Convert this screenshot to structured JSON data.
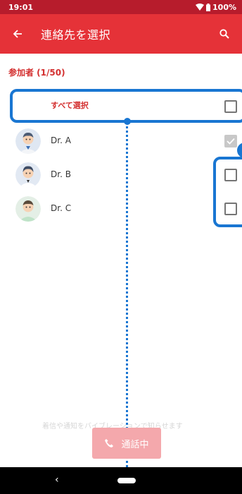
{
  "status_bar": {
    "time": "19:01",
    "battery": "100%",
    "icons": [
      "wifi-icon",
      "battery-icon"
    ]
  },
  "app_bar": {
    "title": "連絡先を選択",
    "back_icon": "arrow-left-icon",
    "search_icon": "search-icon"
  },
  "section": {
    "header": "参加者 (1/50)"
  },
  "select_all": {
    "label": "すべて選択",
    "checked": false
  },
  "contacts": [
    {
      "name": "Dr. A",
      "checked": true,
      "disabled": true
    },
    {
      "name": "Dr. B",
      "checked": false,
      "disabled": false
    },
    {
      "name": "Dr. C",
      "checked": false,
      "disabled": false
    }
  ],
  "footer": {
    "hint": "着信や通知をバイブレーションで知らせます",
    "call_button_label": "通話中",
    "call_icon": "phone-icon"
  },
  "nav_bar": {
    "back": "‹"
  },
  "colors": {
    "status_bar": "#b71c2c",
    "app_bar": "#e53238",
    "accent_text": "#d32f2f",
    "annotation": "#1976d2",
    "call_button": "#f4a8ac"
  }
}
